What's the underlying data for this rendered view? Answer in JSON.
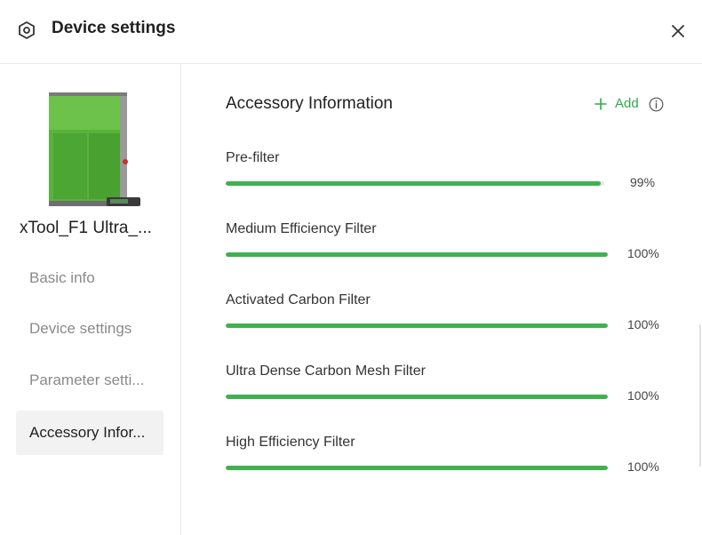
{
  "header": {
    "title": "Device settings"
  },
  "sidebar": {
    "device_name": "xTool_F1 Ultra_...",
    "nav": [
      {
        "label": "Basic info",
        "active": false
      },
      {
        "label": "Device settings",
        "active": false
      },
      {
        "label": "Parameter setti...",
        "active": false
      },
      {
        "label": "Accessory Infor...",
        "active": true
      }
    ]
  },
  "main": {
    "section_title": "Accessory Information",
    "add_label": "Add",
    "accessories": [
      {
        "name": "Pre-filter",
        "percent_label": "99%",
        "level": 99
      },
      {
        "name": "Medium Efficiency Filter",
        "percent_label": "100%",
        "level": 100
      },
      {
        "name": "Activated Carbon Filter",
        "percent_label": "100%",
        "level": 100
      },
      {
        "name": "Ultra Dense Carbon Mesh Filter",
        "percent_label": "100%",
        "level": 100
      },
      {
        "name": "High Efficiency Filter",
        "percent_label": "100%",
        "level": 100
      }
    ]
  },
  "colors": {
    "accent": "#3fb14f",
    "add_text": "#2ea94a",
    "active_bg": "#f2f2f2"
  },
  "icons": {
    "settings": "hexagon-settings-icon",
    "close": "close-icon",
    "add": "plus-icon",
    "info": "info-icon"
  }
}
